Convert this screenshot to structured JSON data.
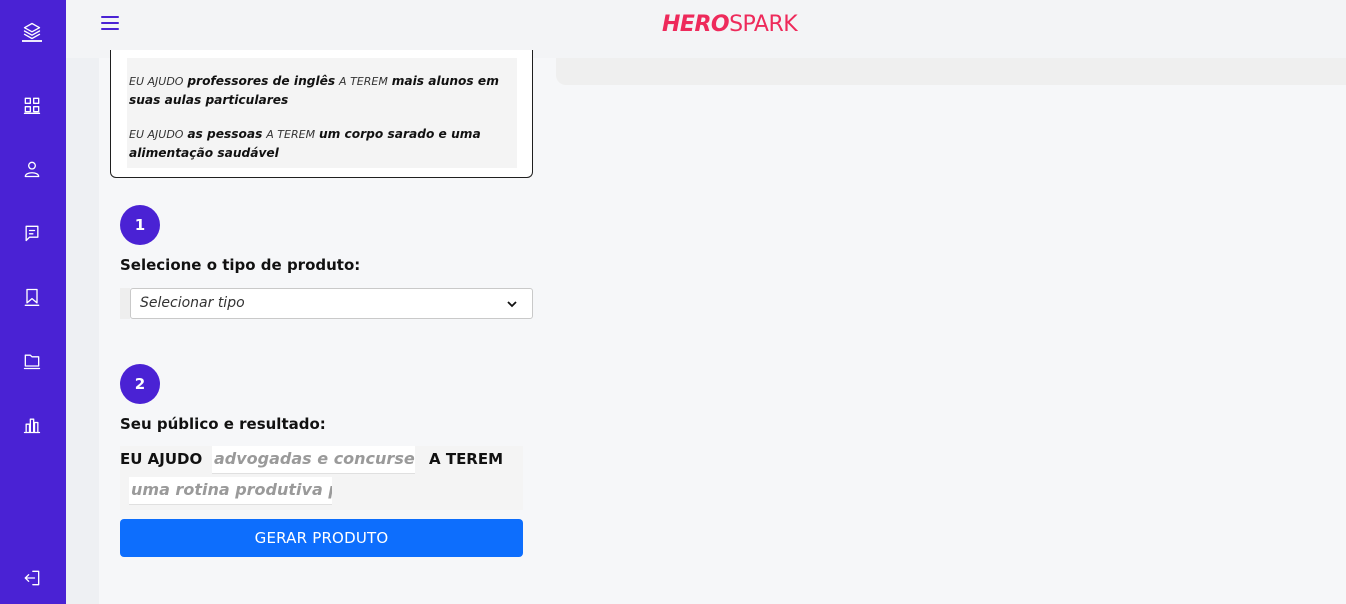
{
  "colors": {
    "sidebar": "#4a22d4",
    "accent": "#4a22d4",
    "brand": "#ee2a5b",
    "button": "#0d6efd"
  },
  "sidebar": {
    "items": [
      {
        "icon": "layers-icon",
        "active": true
      },
      {
        "icon": "grid-icon"
      },
      {
        "icon": "user-icon"
      },
      {
        "icon": "message-icon"
      },
      {
        "icon": "bookmark-icon"
      },
      {
        "icon": "folder-icon"
      },
      {
        "icon": "bar-chart-icon"
      },
      {
        "icon": "logout-icon"
      }
    ]
  },
  "header": {
    "logo_hero": "HERO",
    "logo_spark": "SPARK"
  },
  "examples": [
    {
      "p1": "EU AJUDO",
      "audience": "professores de inglês",
      "p2": "A TEREM",
      "result": "mais alunos em suas aulas particulares"
    },
    {
      "p1": "EU AJUDO",
      "audience": "as pessoas",
      "p2": "A TEREM",
      "result": "um corpo sarado e uma alimentação saudável"
    }
  ],
  "step1": {
    "number": "1",
    "label": "Selecione o tipo de produto:",
    "select_value": "Selecionar tipo"
  },
  "step2": {
    "number": "2",
    "label": "Seu público e resultado:",
    "prefix": "EU AJUDO",
    "audience_placeholder": "advogadas e concurseiras",
    "middle": "A TEREM",
    "result_placeholder": "uma rotina produtiva pa"
  },
  "generate_label": "GERAR PRODUTO"
}
